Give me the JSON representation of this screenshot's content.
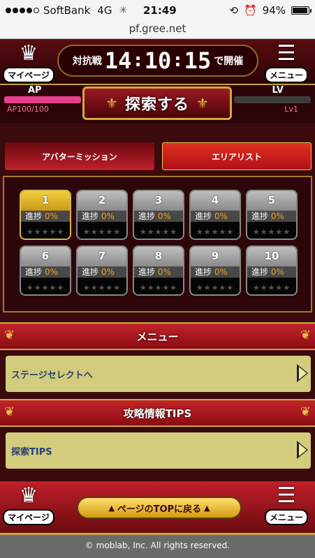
{
  "statusbar": {
    "carrier": "SoftBank",
    "network": "4G",
    "time": "21:49",
    "battery": "94%",
    "battery_level": 0.94
  },
  "url": "pf.gree.net",
  "header": {
    "mypage_label": "マイページ",
    "menu_label": "メニュー",
    "countdown_prefix": "対抗戦",
    "countdown_hh": "14",
    "countdown_mm": "10",
    "countdown_ss": "15",
    "countdown_suffix": "で開催"
  },
  "stats": {
    "ap_label": "AP",
    "ap_value": "AP100/100",
    "ap_fraction": 1.0,
    "lv_label": "LV",
    "lv_value": "Lv1",
    "lv_fraction": 0.0
  },
  "explore_button": "探索する",
  "tabs": {
    "avatar_mission": "アバターミッション",
    "area_list": "エリアリスト"
  },
  "areas": [
    {
      "num": "1",
      "progress_label": "進捗",
      "progress": "0%",
      "active": true
    },
    {
      "num": "2",
      "progress_label": "進捗",
      "progress": "0%",
      "active": false
    },
    {
      "num": "3",
      "progress_label": "進捗",
      "progress": "0%",
      "active": false
    },
    {
      "num": "4",
      "progress_label": "進捗",
      "progress": "0%",
      "active": false
    },
    {
      "num": "5",
      "progress_label": "進捗",
      "progress": "0%",
      "active": false
    },
    {
      "num": "6",
      "progress_label": "進捗",
      "progress": "0%",
      "active": false
    },
    {
      "num": "7",
      "progress_label": "進捗",
      "progress": "0%",
      "active": false
    },
    {
      "num": "8",
      "progress_label": "進捗",
      "progress": "0%",
      "active": false
    },
    {
      "num": "9",
      "progress_label": "進捗",
      "progress": "0%",
      "active": false
    },
    {
      "num": "10",
      "progress_label": "進捗",
      "progress": "0%",
      "active": false
    }
  ],
  "menu_section": {
    "title": "メニュー",
    "stage_select": "ステージセレクトへ"
  },
  "tips_section": {
    "title": "攻略情報TIPS",
    "explore_tips": "探索TIPS"
  },
  "footer": {
    "mypage_label": "マイページ",
    "menu_label": "メニュー",
    "back_to_top": "ページのTOPに戻る",
    "copyright": "© moblab, Inc. All rights reserved."
  },
  "colors": {
    "ap_bar": "#e83e8c",
    "progress_pct": "#f1a020",
    "active_area": "#d7b84a",
    "link_bg": "#d2cc7c"
  }
}
